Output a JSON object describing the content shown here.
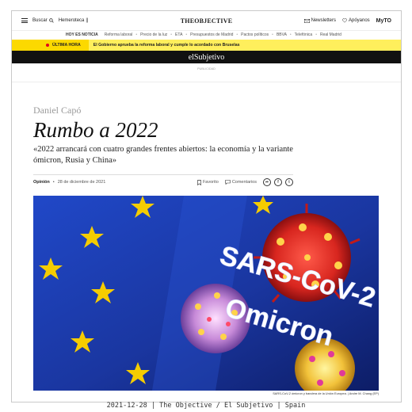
{
  "topbar": {
    "menu_label": "Buscar",
    "hemeroteca_label": "Hemeroteca",
    "logo": "THEOBJECTIVE",
    "newsletters_label": "Newsletters",
    "support_label": "Apóyanos",
    "myto_label": "MyTO"
  },
  "nav": {
    "label": "HOY ES NOTICIA",
    "items": [
      "Reforma laboral",
      "Precio de la luz",
      "ETA",
      "Presupuestos de Madrid",
      "Pactos políticos",
      "BBVA",
      "Telefónica",
      "Real Madrid"
    ]
  },
  "breaking": {
    "tag": "ÚLTIMA HORA",
    "text": "El Gobierno aprueba la reforma laboral y cumple lo acordado con Bruselas"
  },
  "section": {
    "name": "elSubjetivo"
  },
  "ad": {
    "label": "PUBLICIDAD"
  },
  "article": {
    "author": "Daniel Capó",
    "title": "Rumbo a 2022",
    "subtitle": "«2022 arrancará con cuatro grandes frentes abiertos: la economía y la variante ómicron, Rusia y China»",
    "section": "Opinión",
    "date": "28 de diciembre de 2021",
    "favorite_label": "Favorito",
    "comments_label": "Comentarios",
    "image_text_1": "SARS-CoV-2",
    "image_text_2": "Omicron",
    "caption": "SARS-CoV-2 ómicron y bandera de la Unión Europea. | Andre M. Chang (EP)"
  },
  "footer": {
    "text": "2021-12-28 | The Objective / El Subjetivo | Spain"
  },
  "colors": {
    "breaking_yellow": "#fcd900",
    "breaking_dot": "#e2001a",
    "section_bar": "#111111",
    "eu_blue": "#1d3fb0",
    "eu_star": "#f5cc00"
  },
  "icons": [
    "menu-icon",
    "search-icon",
    "mail-icon",
    "heart-icon",
    "bookmark-icon",
    "comment-icon",
    "share-icon",
    "facebook-icon",
    "twitter-icon"
  ]
}
